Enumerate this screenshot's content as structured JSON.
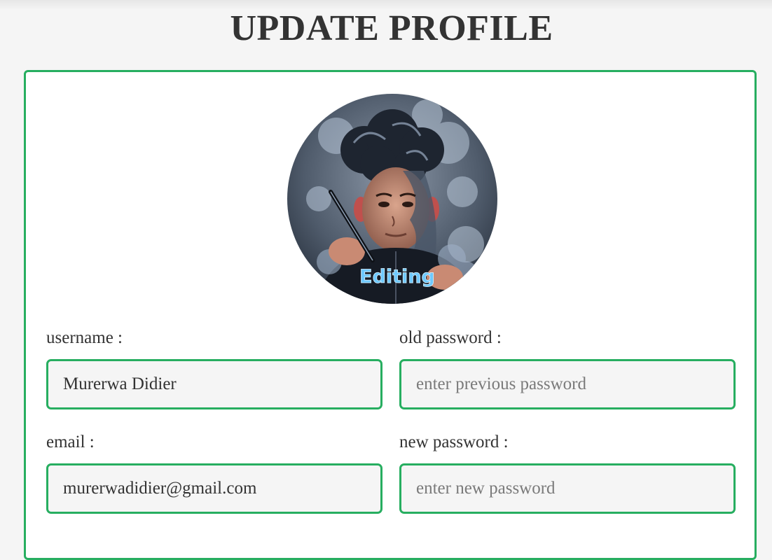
{
  "page": {
    "title": "UPDATE PROFILE"
  },
  "profile": {
    "avatar_caption": "Editing"
  },
  "form": {
    "username": {
      "label": "username :",
      "value": "Murerwa Didier"
    },
    "email": {
      "label": "email :",
      "value": "murerwadidier@gmail.com"
    },
    "old_password": {
      "label": "old password :",
      "placeholder": "enter previous password",
      "value": ""
    },
    "new_password": {
      "label": "new password :",
      "placeholder": "enter new password",
      "value": ""
    }
  },
  "colors": {
    "accent": "#27ae60",
    "background": "#f5f5f5",
    "text": "#333333",
    "input_background": "#f5f5f5"
  }
}
